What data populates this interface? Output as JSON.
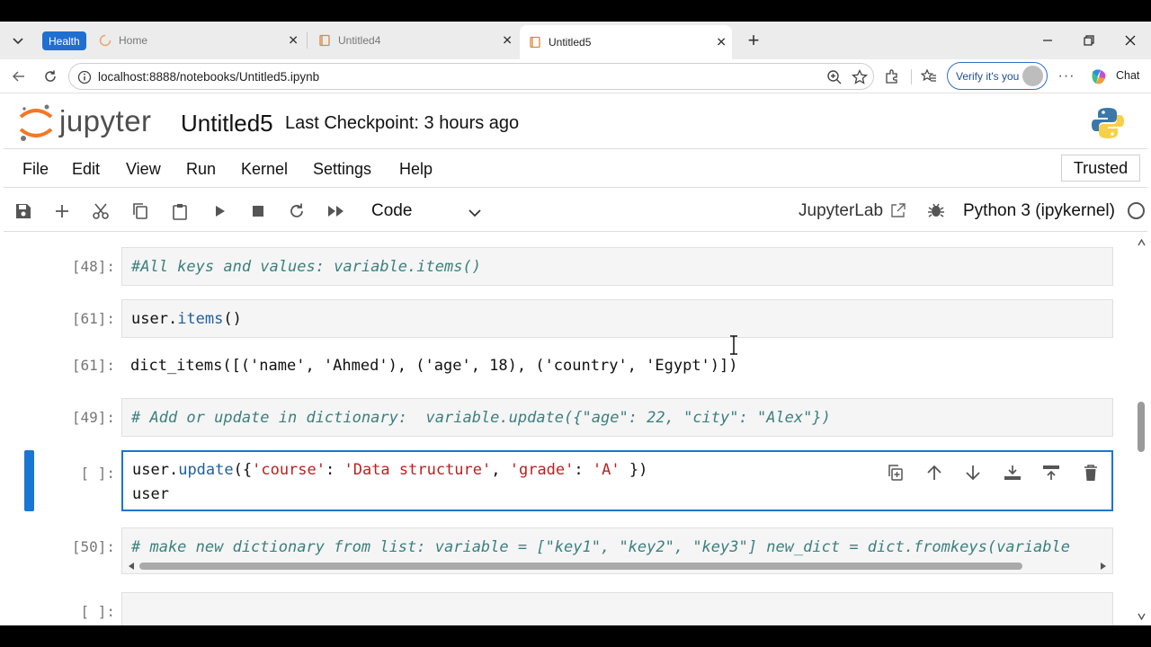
{
  "browser": {
    "health_badge": "Health",
    "tabs": [
      {
        "label": "Home"
      },
      {
        "label": "Untitled4"
      },
      {
        "label": "Untitled5"
      }
    ],
    "url": "localhost:8888/notebooks/Untitled5.ipynb",
    "verify_label": "Verify it's you",
    "chat_label": "Chat"
  },
  "jupyter": {
    "logo_text": "jupyter",
    "notebook_title": "Untitled5",
    "checkpoint": "Last Checkpoint: 3 hours ago",
    "menu": [
      "File",
      "Edit",
      "View",
      "Run",
      "Kernel",
      "Settings",
      "Help"
    ],
    "trusted_label": "Trusted",
    "cell_type": "Code",
    "jupyterlab_label": "JupyterLab",
    "kernel_name": "Python 3 (ipykernel)"
  },
  "cells": {
    "c1": {
      "prompt": "[48]:",
      "text": "#All keys and values: variable.items()"
    },
    "c2": {
      "prompt": "[61]:",
      "obj": "user",
      "dot": ".",
      "method": "items",
      "tail": "()"
    },
    "c2_out": {
      "prompt": "[61]:",
      "text": "dict_items([('name', 'Ahmed'), ('age', 18), ('country', 'Egypt')])"
    },
    "c3": {
      "prompt": "[49]:",
      "text": "# Add or update in dictionary:  variable.update({\"age\": 22, \"city\": \"Alex\"})"
    },
    "c4": {
      "prompt": "[ ]:",
      "l1_obj": "user",
      "l1_dot": ".",
      "l1_method": "update",
      "l1_open": "({",
      "l1_s1": "'course'",
      "l1_colon1": ": ",
      "l1_s2": "'Data structure'",
      "l1_comma": ", ",
      "l1_s3": "'grade'",
      "l1_colon2": ": ",
      "l1_s4": "'A'",
      "l1_close": " })",
      "l2": "user"
    },
    "c5": {
      "prompt": "[50]:",
      "text": "# make new dictionary from list: variable = [\"key1\", \"key2\", \"key3\"] new_dict = dict.fromkeys(variable"
    },
    "c6": {
      "prompt": "[ ]:"
    }
  },
  "colors": {
    "accent": "#1976d2",
    "comment": "#3d7f7f",
    "string": "#ba2121",
    "method": "#2060a0",
    "health_badge": "#1f6fd0"
  }
}
